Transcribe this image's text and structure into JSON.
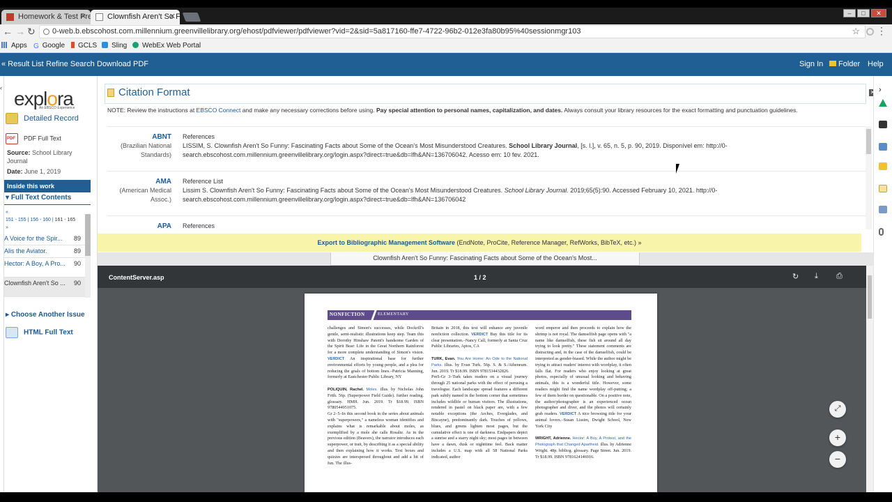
{
  "browser": {
    "tabs": [
      {
        "title": "Homework & Test Prep |",
        "icon_color": "#c0392b"
      },
      {
        "title": "Clownfish Aren't So Funn",
        "icon_color": "#888888"
      }
    ],
    "url": "0-web.b.ebscohost.com.millennium.greenvillelibrary.org/ehost/pdfviewer/pdfviewer?vid=2&sid=5a817160-ffe7-4722-96b2-012e3fa80b95%40sessionmgr103",
    "bookmarks": [
      "Apps",
      "Google",
      "GCLS",
      "Sling",
      "WebEx Web Portal"
    ]
  },
  "toolbar": {
    "result_list": "« Result List",
    "refine_search": "Refine Search",
    "download_pdf": "Download PDF",
    "sign_in": "Sign In",
    "folder": "Folder",
    "help": "Help"
  },
  "sidebar": {
    "logo": "explora",
    "logo_sub": "An EBSCO Experience",
    "detailed_record": "Detailed Record",
    "pdf_full_text": "PDF Full Text",
    "source_label": "Source:",
    "source_value": "School Library Journal",
    "date_label": "Date:",
    "date_value": "June 1, 2019",
    "inside_header": "Inside this work",
    "full_text_contents": "Full Text Contents",
    "page_ranges": [
      "«",
      "151 - 155",
      "156 - 160",
      "161 - 165",
      "»"
    ],
    "issues": [
      {
        "title": "A Voice for the Spir...",
        "page": "89"
      },
      {
        "title": "Alis the Aviator.",
        "page": "89"
      },
      {
        "title": "Hector: A Boy, A Pro...",
        "page": "90"
      },
      {
        "title": "Clownfish Aren't So ...",
        "page": "90"
      }
    ],
    "choose_issue": "Choose Another Issue",
    "html_full_text": "HTML Full Text"
  },
  "citation": {
    "title": "Citation Format",
    "note_prefix": "NOTE: Review the instructions at ",
    "note_link": "EBSCO Connect",
    "note_mid": " and make any necessary corrections before using. ",
    "note_bold": "Pay special attention to personal names, capitalization, and dates.",
    "note_suffix": " Always consult your library resources for the exact formatting and punctuation guidelines.",
    "entries": [
      {
        "abbr": "ABNT",
        "name": "(Brazilian National Standards)",
        "heading": "References",
        "text_a": "LISSIM, S. Clownfish Aren't So Funny: Fascinating Facts about Some of the Ocean's Most Misunderstood Creatures. ",
        "journal": "School Library Journal",
        "text_b": ", [s. l.], v. 65, n. 5, p. 90, 2019. Disponível em: http://0-search.ebscohost.com.millennium.greenvillelibrary.org/login.aspx?direct=true&db=lfh&AN=136706042. Acesso em: 10 fev. 2021."
      },
      {
        "abbr": "AMA",
        "name": "(American Medical Assoc.)",
        "heading": "Reference List",
        "text_a": "Lissim S. Clownfish Aren't So Funny: Fascinating Facts about Some of the Ocean's Most Misunderstood Creatures. ",
        "journal": "School Library Journal.",
        "text_b": " 2019;65(5):90. Accessed February 10, 2021. http://0-search.ebscohost.com.millennium.greenvillelibrary.org/login.aspx?direct=true&db=lfh&AN=136706042"
      },
      {
        "abbr": "APA",
        "name": "",
        "heading": "References",
        "text_a": "",
        "journal": "",
        "text_b": ""
      }
    ],
    "export_bold": "Export to Bibliographic Management Software",
    "export_rest": " (EndNote, ProCite, Reference Manager, RefWorks, BibTeX, etc.) »"
  },
  "pdf": {
    "tab_title": "Clownfish Aren't So Funny: Fascinating Facts about Some of the Ocean's Most...",
    "file_name": "ContentServer.asp",
    "page_indicator": "1 / 2",
    "band_left": "NONFICTION",
    "band_right": "ELEMENTARY",
    "col1_a": "challenges and Simon's successes, while Dockrill's gentle, semi-realistic illustrations keep step. Team this with Dorothy Hinshaw Patent's handsome Garden of the Spirit Bear: Life in the Great Northern Rainforest for a more complete understanding of Simon's vision. ",
    "col1_verdict": "VERDICT",
    "col1_b": " An inspirational base for further environmental efforts by young people, and a plea for reducing the goals of bottom lines.–Patricia Manning, formerly at Eastchester Public Library, NY",
    "col1_h": "POLIQUIN, Rachel.",
    "col1_t": " Moles.",
    "col1_c": " illus. by Nicholas John Frith. 56p. (Superpower Field Guide). further reading. glossary. HMH. Jun. 2019. Tr $18.99. ISBN 9780544951075.",
    "col1_d": "Gr 2–5–In this second book in the series about animals with \"superpowers,\" a nameless woman identifies and explains what is remarkable about moles, as exemplified by a mole she calls Rosalie. As in the previous edition (Beavers), the narrator introduces each superpower, or trait, by describing it as a special ability and then explaining how it works. Text boxes and quizzes are interspersed throughout and add a bit of fun. The illus-",
    "col2_a": "Britain in 2018, this text will enhance any juvenile nonfiction collection. ",
    "col2_verdict": "VERDICT",
    "col2_b": " Buy this title for its clear presentation.–Nancy Call, formerly at Santa Cruz Public Libraries, Aptos, CA",
    "col2_h": "TURK, Evan.",
    "col2_t": " You Are Home: An Ode to the National Parks.",
    "col2_c": " illus. by Evan Turk. 56p. S. & S./Atheneum. Jun. 2019. Tr $18.99. ISBN 9781534432826.",
    "col2_d": "PreS-Gr 3–Turk takes readers on a visual journey through 25 national parks with the effect of perusing a travelogue. Each landscape spread features a different park subtly named in the bottom corner that sometimes includes wildlife or human visitors. The illustrations, rendered in pastel on black paper are, with a few notable exceptions (the Arches, Everglades, and Biscayne), predominantly dark. Touches of yellows, blues, and greens lighten most pages, but the cumulative effect is one of darkness. Endpapers depict a sunrise and a starry night sky; most pages in between have a dawn, dusk or nighttime feel. Back matter includes a U.S. map with all 58 National Parks indicated, author",
    "col3_a": "word emperor and then proceeds to explain how the shrimp is not royal. The damselfish page opens with \"a name like damselfish, these fish sit around all day trying to look pretty.\" These statement comments are distracting and, in the case of the damselfish, could be interpreted as gender-biased. While the author might be trying to attract readers' interest with wordplay, it often falls flat. For readers who enjoy looking at great photos, especially of unusual looking and behaving animals, this is a wonderful title. However, some readers might find the name wordplay off-putting; a few of them border on questionable. On a positive note, the author/photographer is an experienced ocean photographer and diver, and the photos will certainly grab readers. ",
    "col3_verdict": "VERDICT",
    "col3_b": " A nice browsing title for your animal lovers.–Susan Lissim, Dwight School, New York City",
    "col3_h": "WRIGHT, Adrienne.",
    "col3_t": " Hector: A Boy, A Protest, and the Photograph that Changed Apartheid.",
    "col3_c": " illus. by Adrienne Wright. 48p. bibliog. glossary. Page Street. Jun. 2019. Tr $18.99. ISBN 9781624146916."
  },
  "colors": {
    "ebsco_blue": "#1f5f94",
    "link_blue": "#1a5a96",
    "export_yellow": "#f8f4a9",
    "band_purple": "#5e4b8c",
    "pdf_bg": "#525659",
    "pdf_toolbar": "#323639"
  },
  "icons": [
    "refresh-icon",
    "download-icon",
    "print-icon",
    "fit-page-icon",
    "zoom-in-icon",
    "zoom-out-icon",
    "star-icon",
    "folder-icon"
  ]
}
